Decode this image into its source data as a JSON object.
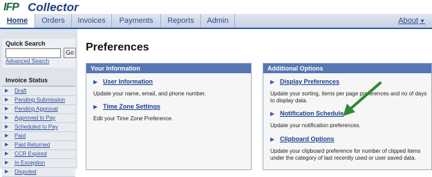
{
  "app": {
    "logo_text": "IFP",
    "title": "Collector"
  },
  "nav": {
    "tabs": [
      "Home",
      "Orders",
      "Invoices",
      "Payments",
      "Reports",
      "Admin"
    ],
    "about_label": "About"
  },
  "sidebar": {
    "quick_search_title": "Quick Search",
    "go_label": "Go",
    "advanced_search_label": "Advanced Search",
    "invoice_status_title": "Invoice Status",
    "status_items": [
      "Draft",
      "Pending Submission",
      "Pending Approval",
      "Approved to Pay",
      "Scheduled to Pay",
      "Paid",
      "Paid Returned",
      "CCR Expired",
      "In Exception",
      "Disputed"
    ]
  },
  "main": {
    "page_title": "Preferences",
    "your_information": {
      "header": "Your Information",
      "options": [
        {
          "label": "User Information",
          "desc": "Update your name, email, and phone number."
        },
        {
          "label": "Time Zone Settings",
          "desc": "Edit your Time Zone Preference."
        }
      ]
    },
    "additional_options": {
      "header": "Additional Options",
      "options": [
        {
          "label": "Display Preferences",
          "desc": "Update your sorting, items per page preferences and no of days to display data."
        },
        {
          "label": "Notification Schedule",
          "desc": "Update your notification preferences."
        },
        {
          "label": "Clipboard Options",
          "desc": "Update your clipboard preference for number of clipped items under the category of last recently used or user saved data."
        }
      ]
    }
  },
  "colors": {
    "accent": "#2a5caa",
    "panel_header": "#5677b3",
    "annotation_arrow": "#2e8b2e"
  }
}
